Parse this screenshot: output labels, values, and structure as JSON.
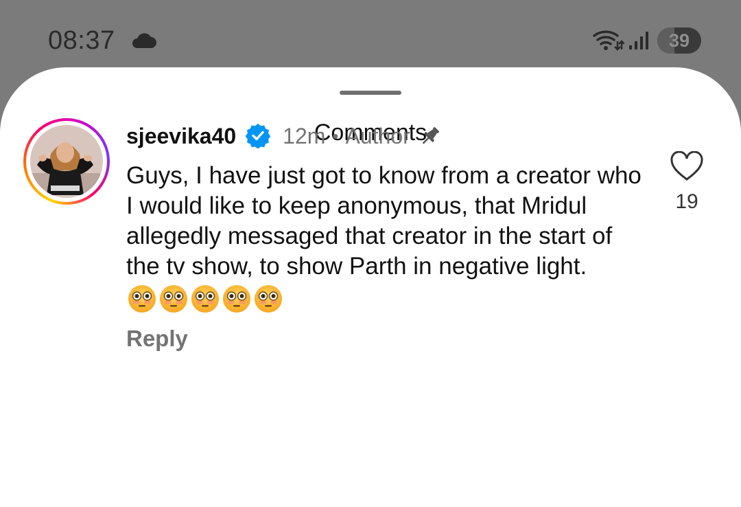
{
  "status_bar": {
    "time": "08:37",
    "battery_level": "39",
    "battery_fraction": 0.39
  },
  "sheet": {
    "title": "Comments"
  },
  "comment": {
    "username": "sjeevika40",
    "time_ago": "12m",
    "separator": "•",
    "author_label": "Author",
    "text": "Guys, I have just got to know from a creator who I would like to keep anonymous, that Mridul allegedly messaged that creator in the start of the tv show, to show Parth in negative light.",
    "emojis": [
      "flushed-face",
      "flushed-face",
      "flushed-face",
      "flushed-face",
      "flushed-face"
    ],
    "reply_label": "Reply",
    "like_count": "19"
  },
  "colors": {
    "verified_blue": "#0095f6",
    "secondary_text": "#737373",
    "status_bar_bg": "#7b7b7b"
  },
  "icons": {
    "status": [
      "cloud-icon",
      "wifi-icon",
      "signal-icon"
    ],
    "comment": [
      "verified-badge-icon",
      "pin-icon",
      "heart-icon"
    ]
  }
}
